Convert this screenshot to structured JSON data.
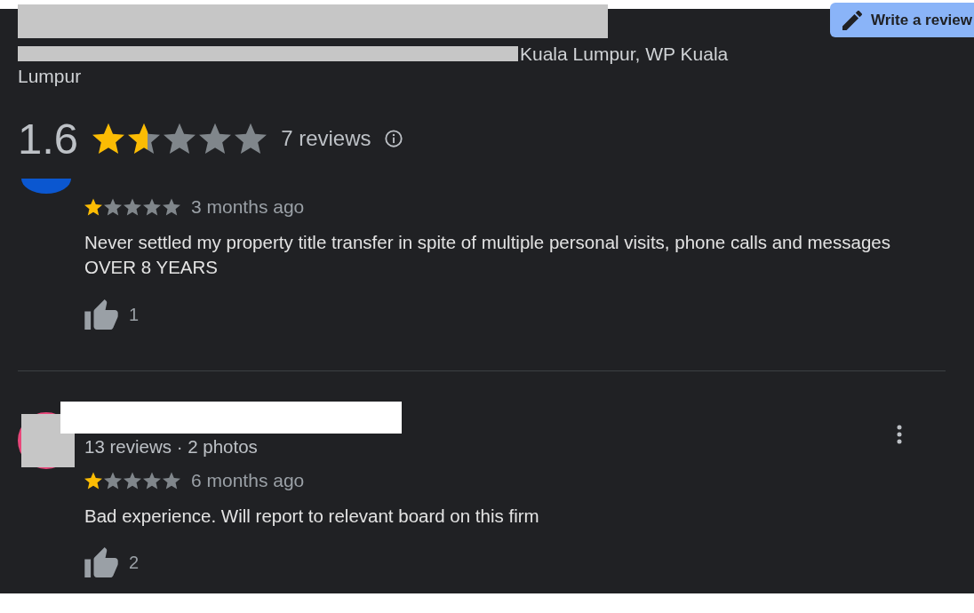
{
  "write_review_button": "Write a review",
  "place": {
    "address_lines": [
      "Kuala Lumpur, WP Kuala",
      "Lumpur"
    ]
  },
  "rating": {
    "value": "1.6",
    "stars": 1.6,
    "count": "7 reviews"
  },
  "reviews": [
    {
      "color": "#0b57d0",
      "more_menu": false,
      "stars": 1,
      "time": "3 months ago",
      "text": "Never settled my property title transfer in spite of multiple personal visits, phone calls and messages OVER 8 YEARS",
      "likes": "1",
      "redacted": false
    },
    {
      "color": "#e8477a",
      "author_meta": "13 reviews · 2 photos",
      "more_menu": true,
      "stars": 1,
      "time": "6 months ago",
      "text": "Bad experience. Will report to relevant board on this firm",
      "likes": "2",
      "redacted": true
    }
  ]
}
